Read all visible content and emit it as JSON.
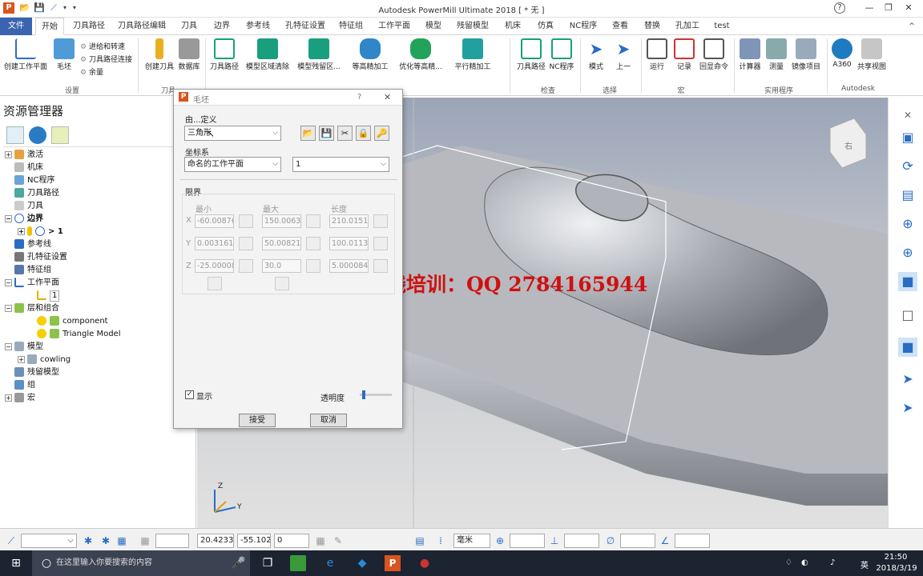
{
  "window": {
    "title": "Autodesk PowerMill Ultimate 2018    [ * 无 ]",
    "help": "?",
    "minimize": "—",
    "restore": "❐",
    "close": "✕",
    "collapse": "^"
  },
  "tabs": [
    "文件",
    "开始",
    "刀具路径",
    "刀具路径编辑",
    "刀具",
    "边界",
    "参考线",
    "孔特征设置",
    "特征组",
    "工作平面",
    "模型",
    "残留模型",
    "机床",
    "仿真",
    "NC程序",
    "查看",
    "替换",
    "孔加工",
    "test"
  ],
  "ribbon": {
    "buttons": [
      "创建工作平面",
      "毛坯",
      "创建刀具",
      "数据库",
      "刀具路径",
      "模型区域清除",
      "模型残留区...",
      "等高精加工",
      "优化等高精...",
      "平行精加工",
      "刀具路径",
      "NC程序",
      "模式",
      "上一",
      "运行",
      "记录",
      "回显命令",
      "计算器",
      "测量",
      "镜像项目",
      "A360",
      "共享视图"
    ],
    "small": [
      "进给和转速",
      "刀具路径连接",
      "余量"
    ],
    "groups": [
      "设置",
      "刀具",
      "检查",
      "选择",
      "宏",
      "实用程序",
      "Autodesk"
    ]
  },
  "explorer": {
    "title": "资源管理器",
    "tree": [
      "激活",
      "机床",
      "NC程序",
      "刀具路径",
      "刀具",
      "边界",
      "> 1",
      "参考线",
      "孔特征设置",
      "特征组",
      "工作平面",
      "1",
      "层和组合",
      "component",
      "Triangle Model",
      "模型",
      "cowling",
      "残留模型",
      "组",
      "宏"
    ]
  },
  "dialog": {
    "title": "毛坯",
    "help": "?",
    "close": "✕",
    "define_by_label": "由...定义",
    "define_by_value": "三角形",
    "coord_label": "坐标系",
    "coord_value": "命名的工作平面",
    "workplane_value": "1",
    "limits_label": "限界",
    "col_min": "最小",
    "col_max": "最大",
    "col_len": "长度",
    "axes": [
      "X",
      "Y",
      "Z"
    ],
    "x": [
      "-60.00876",
      "150.0063",
      "210.0151"
    ],
    "y": [
      "0.003161",
      "50.00821",
      "100.0113"
    ],
    "z": [
      "-25.00008",
      "30.0",
      "5.000084"
    ],
    "show_label": "显示",
    "transparency_label": "透明度",
    "transparency_value": 0.08,
    "accept": "接受",
    "cancel": "取消"
  },
  "watermark": "北斗编程在线培训：QQ 2784165944",
  "viewcube_label": "右",
  "axis_labels": [
    "Z",
    "Y",
    "X"
  ],
  "status": {
    "x": "20.4233",
    "y": "-55.102",
    "z": "0",
    "units": "毫米"
  },
  "taskbar": {
    "search_placeholder": "在这里输入你要搜索的内容",
    "time": "21:50",
    "date": "2018/3/19",
    "lang": "英"
  }
}
